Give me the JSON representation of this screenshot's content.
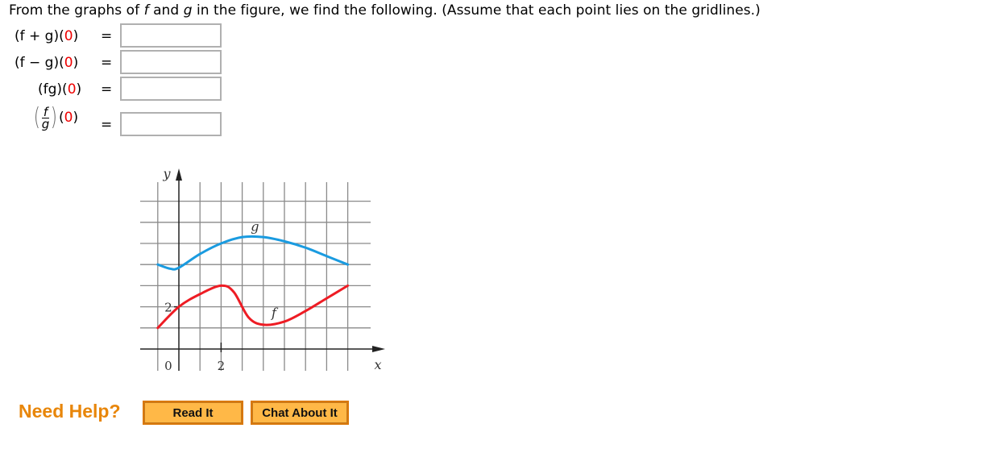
{
  "prompt": {
    "before_f": "From the graphs of ",
    "f": "f",
    "mid": " and ",
    "g": "g",
    "after": " in the figure, we find the following. (Assume that each point lies on the gridlines.)"
  },
  "questions": [
    {
      "open": "(f + g)(",
      "arg": "0",
      "close": ")",
      "equals": "=",
      "value": "",
      "placeholder": ""
    },
    {
      "open": "(f − g)(",
      "arg": "0",
      "close": ")",
      "equals": "=",
      "value": "",
      "placeholder": ""
    },
    {
      "open": "(fg)(",
      "arg": "0",
      "close": ")",
      "equals": "=",
      "value": "",
      "placeholder": ""
    },
    {
      "frac_num": "f",
      "frac_den": "g",
      "open": "(",
      "arg": "0",
      "close": ")",
      "equals": "=",
      "value": "",
      "placeholder": ""
    }
  ],
  "colors": {
    "g_curve": "#1a9be0",
    "f_curve": "#ee1c24",
    "accent": "#e8860a",
    "button_fill": "#ffb847"
  },
  "chart_data": {
    "type": "line",
    "title": "",
    "xlabel": "x",
    "ylabel": "y",
    "xlim": [
      -1,
      8
    ],
    "ylim": [
      0,
      7
    ],
    "grid": true,
    "x_tick_labels": [
      {
        "x": 0,
        "label": "0"
      },
      {
        "x": 2,
        "label": "2"
      }
    ],
    "y_tick_labels": [
      {
        "y": 2,
        "label": "2"
      }
    ],
    "series": [
      {
        "name": "g",
        "label_at": [
          3.6,
          5.6
        ],
        "points": [
          [
            -1,
            4
          ],
          [
            -0.4,
            3.8
          ],
          [
            0,
            3.85
          ],
          [
            1,
            4.5
          ],
          [
            2,
            5
          ],
          [
            3,
            5.3
          ],
          [
            4,
            5.3
          ],
          [
            5,
            5.1
          ],
          [
            6,
            4.8
          ],
          [
            7,
            4.4
          ],
          [
            8,
            4
          ]
        ]
      },
      {
        "name": "f",
        "label_at": [
          4.5,
          1.5
        ],
        "points": [
          [
            -1,
            1
          ],
          [
            0,
            2
          ],
          [
            1,
            2.6
          ],
          [
            2,
            3
          ],
          [
            2.6,
            2.7
          ],
          [
            3.3,
            1.5
          ],
          [
            4,
            1.15
          ],
          [
            5,
            1.3
          ],
          [
            6,
            1.8
          ],
          [
            7,
            2.4
          ],
          [
            8,
            3
          ]
        ]
      }
    ]
  },
  "help": {
    "label": "Need Help?",
    "read_button": "Read It",
    "chat_button": "Chat About It"
  }
}
